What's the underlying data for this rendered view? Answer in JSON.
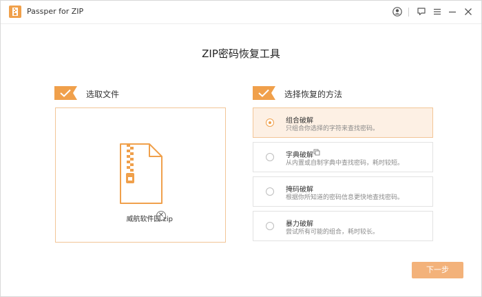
{
  "window": {
    "title": "Passper for ZIP"
  },
  "header": {
    "title": "ZIP密码恢复工具"
  },
  "steps": {
    "select_file": "选取文件",
    "select_method": "选择恢复的方法"
  },
  "file": {
    "name": "威航软件园.zip",
    "remove_symbol": "✕"
  },
  "methods": [
    {
      "title": "组合破解",
      "desc": "只组合你选择的字符来查找密码。",
      "selected": true
    },
    {
      "title": "字典破解",
      "desc": "从内置或自制字典中查找密码，耗时较短。",
      "selected": false
    },
    {
      "title": "掩码破解",
      "desc": "根据你所知道的密码信息更快地查找密码。",
      "selected": false
    },
    {
      "title": "暴力破解",
      "desc": "尝试所有可能的组合，耗时较长。",
      "selected": false
    }
  ],
  "footer": {
    "next_label": "下一步"
  },
  "colors": {
    "accent": "#f0a04b",
    "accent_light": "#fdf0e4",
    "button": "#f3b27a"
  }
}
